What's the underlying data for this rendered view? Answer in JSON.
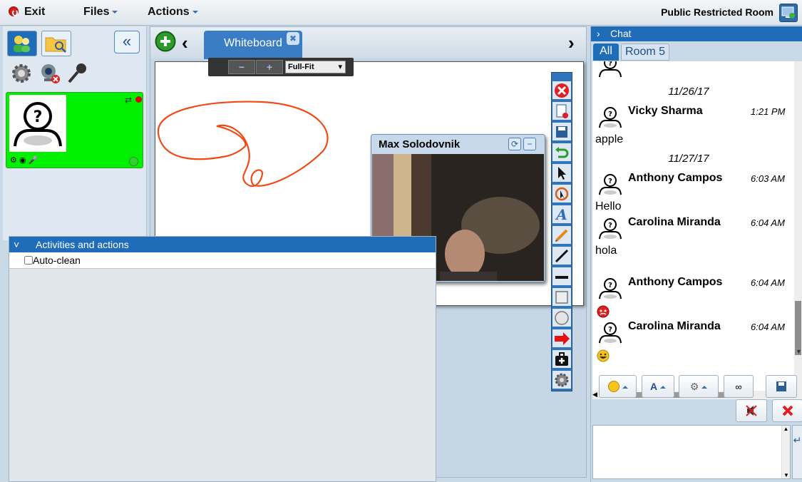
{
  "menubar": {
    "exit_label": "Exit",
    "files_label": "Files",
    "actions_label": "Actions",
    "room_title": "Public Restricted Room"
  },
  "left": {
    "icons": [
      "users-icon",
      "folder-search-icon",
      "gear-icon",
      "webcam-icon",
      "microphone-icon"
    ]
  },
  "whiteboard": {
    "tab_label": "Whiteboard",
    "zoom_minus": "−",
    "zoom_plus": "+",
    "zoom_mode": "Full-Fit",
    "video_title": "Max Solodovnik",
    "tools": [
      "close-tool",
      "document-tool",
      "save-tool",
      "undo-tool",
      "pointer-tool",
      "select-tool",
      "text-tool",
      "pencil-tool",
      "line-tool",
      "underline-tool",
      "rectangle-tool",
      "ellipse-tool",
      "arrow-tool",
      "toolbox-tool",
      "settings-tool"
    ]
  },
  "activities": {
    "header": "Activities and actions",
    "auto_clean_label": "Auto-clean"
  },
  "chat": {
    "header": "Chat",
    "tab_all": "All",
    "tab_room": "Room 5",
    "dates": [
      "11/26/17",
      "11/27/17"
    ],
    "messages": [
      {
        "name": "Vicky Sharma",
        "time": "1:21 PM",
        "text": "apple"
      },
      {
        "name": "Anthony Campos",
        "time": "6:03 AM",
        "text": "Hello"
      },
      {
        "name": "Carolina Miranda",
        "time": "6:04 AM",
        "text": "hola"
      },
      {
        "name": "Anthony Campos",
        "time": "6:04 AM",
        "text": ""
      },
      {
        "name": "Carolina Miranda",
        "time": "6:04 AM",
        "text": ""
      }
    ],
    "controls": {
      "font_label": "A"
    }
  }
}
